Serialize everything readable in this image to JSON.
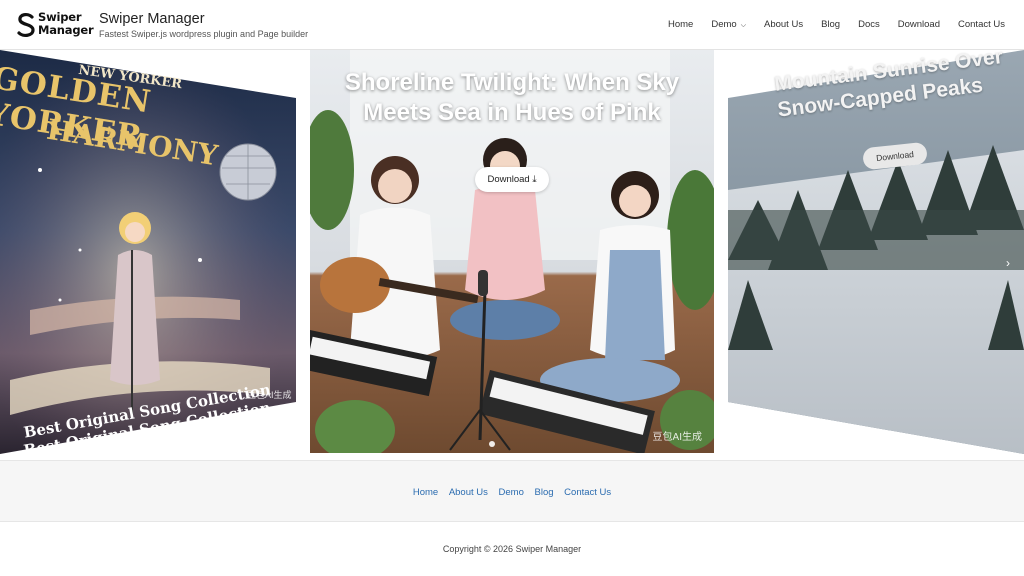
{
  "header": {
    "logo_text_line1": "Swiper",
    "logo_text_line2": "Manager",
    "site_title": "Swiper Manager",
    "tagline": "Fastest Swiper.js wordpress plugin and Page builder",
    "nav": [
      {
        "label": "Home"
      },
      {
        "label": "Demo"
      },
      {
        "label": "About Us"
      },
      {
        "label": "Blog"
      },
      {
        "label": "Docs"
      },
      {
        "label": "Download"
      },
      {
        "label": "Contact Us"
      }
    ]
  },
  "carousel": {
    "left": {
      "heading1": "NEW YORKER",
      "heading2": "GOLDEN YORKER",
      "heading3": "HARMONY",
      "caption1": "Best Original Song Collection",
      "caption2": "Best Original Song Collection",
      "watermark": "豆包AI生成"
    },
    "center": {
      "title": "Shoreline Twilight: When Sky Meets Sea in Hues of Pink",
      "button_label": "Download",
      "watermark": "豆包AI生成"
    },
    "right": {
      "title": "Mountain Sunrise Over Snow-Capped Peaks",
      "button_label": "Download"
    }
  },
  "footer": {
    "links": [
      "Home",
      "About Us",
      "Demo",
      "Blog",
      "Contact Us"
    ],
    "copyright": "Copyright © 2026 Swiper Manager"
  }
}
